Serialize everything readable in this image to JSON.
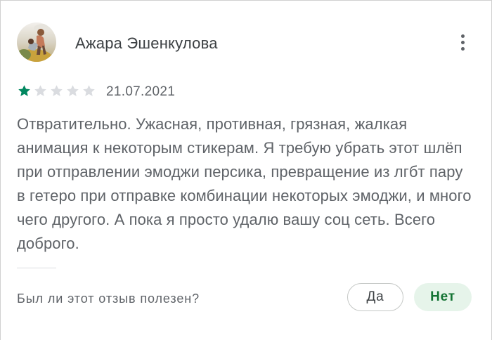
{
  "review": {
    "author_name": "Ажара Эшенкулова",
    "avatar_icon": "user-avatar-photo",
    "more_icon": "more-vert-icon",
    "rating": 1,
    "rating_max": 5,
    "date": "21.07.2021",
    "text": "Отвратительно. Ужасная, противная, грязная, жалкая анимация к некоторым стикерам. Я требую убрать этот шлёп при отправлении эмоджи персика, превращение из лгбт пару в гетеро при отправке комбинации некоторых эмоджи, и много чего другого. А пока я просто удалю вашу соц сеть. Всего доброго."
  },
  "helpful": {
    "question": "Был ли этот отзыв полезен?",
    "yes_label": "Да",
    "no_label": "Нет"
  },
  "colors": {
    "star_filled": "#01875f",
    "star_empty": "#dadce0",
    "no_button_bg": "#e6f4ea",
    "no_button_text": "#137333",
    "text_secondary": "#5f6368"
  }
}
